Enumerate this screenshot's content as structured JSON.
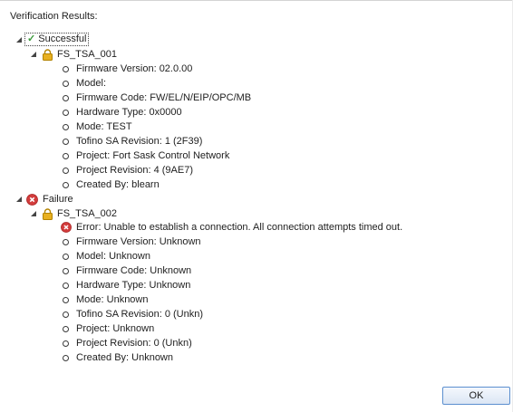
{
  "dialog": {
    "title": "Verification Results:",
    "ok_label": "OK"
  },
  "tree": {
    "success": {
      "label": "Successful",
      "device": {
        "name": "FS_TSA_001",
        "details": [
          "Firmware Version: 02.0.00",
          "Model:",
          "Firmware Code: FW/EL/N/EIP/OPC/MB",
          "Hardware Type: 0x0000",
          "Mode: TEST",
          "Tofino SA Revision: 1 (2F39)",
          "Project: Fort Sask Control Network",
          "Project Revision: 4 (9AE7)",
          "Created By: blearn"
        ]
      }
    },
    "failure": {
      "label": "Failure",
      "device": {
        "name": "FS_TSA_002",
        "error": "Error: Unable to establish a connection. All connection attempts timed out.",
        "details": [
          "Firmware Version: Unknown",
          "Model: Unknown",
          "Firmware Code: Unknown",
          "Hardware Type: Unknown",
          "Mode: Unknown",
          "Tofino SA Revision: 0 (Unkn)",
          "Project: Unknown",
          "Project Revision: 0 (Unkn)",
          "Created By: Unknown"
        ]
      }
    }
  },
  "colors": {
    "success_check": "#3a9a3a",
    "error_red": "#d23c3c",
    "lock_gold": "#e8b020",
    "button_border": "#5b8fcf"
  }
}
